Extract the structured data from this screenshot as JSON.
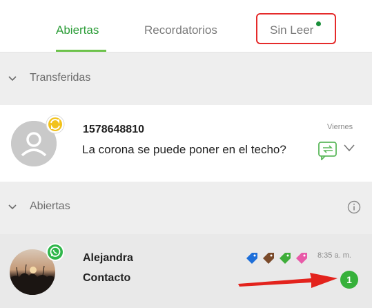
{
  "tabs": [
    {
      "label": "Abiertas",
      "active": true
    },
    {
      "label": "Recordatorios",
      "active": false
    },
    {
      "label": "Sin Leer",
      "active": false,
      "has_unread": true
    }
  ],
  "sections": {
    "transferidas": {
      "label": "Transferidas"
    },
    "abiertas": {
      "label": "Abiertas"
    }
  },
  "conversations": [
    {
      "name": "1578648810",
      "message": "La corona se puede poner en el techo?",
      "time": "Viernes",
      "avatar_icon": "default-user-icon",
      "channel_icon": "transfer-icon"
    },
    {
      "name": "Alejandra",
      "subtitle": "Contacto",
      "time": "8:35 a. m.",
      "unread_count": "1",
      "avatar_icon": "sunset-photo",
      "channel_icon": "whatsapp-icon",
      "tags": [
        "#1e6fd9",
        "#7a4a2a",
        "#3fae3a",
        "#e85aa8"
      ]
    }
  ],
  "colors": {
    "accent": "#2e9e3a",
    "highlight": "#e52b2b",
    "badge": "#37b13b"
  }
}
